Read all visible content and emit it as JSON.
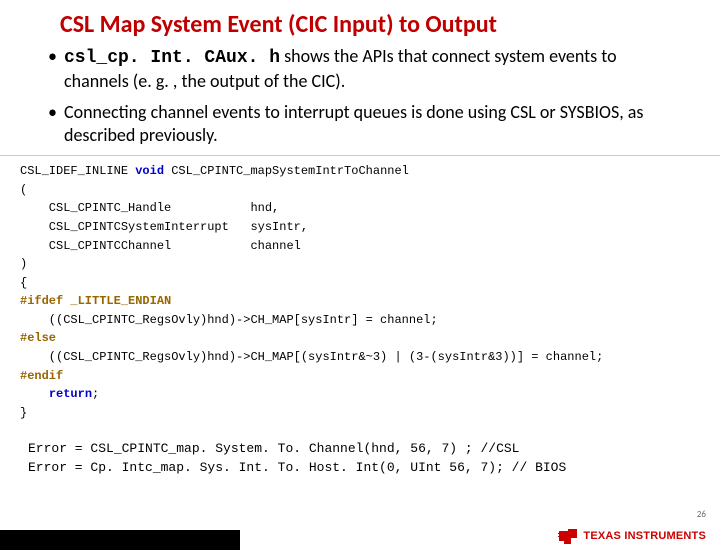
{
  "title": "CSL Map System Event (CIC Input) to Output",
  "bullets": [
    {
      "dot": "•",
      "code": "csl_cp. Int. CAux. h",
      "rest": " shows the APIs that connect system events to channels (e. g. , the output of the CIC)."
    },
    {
      "dot": "•",
      "code": "",
      "rest": "Connecting channel events to interrupt queues is done using CSL or SYSBIOS, as described previously."
    }
  ],
  "code": {
    "l1a": "CSL_IDEF_INLINE ",
    "l1b": "void",
    "l1c": " CSL_CPINTC_mapSystemIntrToChannel",
    "l2": "(",
    "l3": "    CSL_CPINTC_Handle           hnd,",
    "l4": "    CSL_CPINTCSystemInterrupt   sysIntr,",
    "l5": "    CSL_CPINTCChannel           channel",
    "l6": ")",
    "l7": "{",
    "l8": "#ifdef _LITTLE_ENDIAN",
    "l9": "    ((CSL_CPINTC_RegsOvly)hnd)->CH_MAP[sysIntr] = channel;",
    "l10": "#else",
    "l11": "    ((CSL_CPINTC_RegsOvly)hnd)->CH_MAP[(sysIntr&~3) | (3-(sysIntr&3))] = channel;",
    "l12": "#endif",
    "l13a": "    ",
    "l13b": "return",
    "l13c": ";",
    "l14": "}"
  },
  "calls": {
    "c1": "Error = CSL_CPINTC_map. System. To. Channel(hnd, 56, 7) ; //CSL",
    "c2": "Error = Cp. Intc_map. Sys. Int. To. Host. Int(0, UInt 56, 7); // BIOS"
  },
  "page_num": "26",
  "logo_text": "TEXAS INSTRUMENTS"
}
